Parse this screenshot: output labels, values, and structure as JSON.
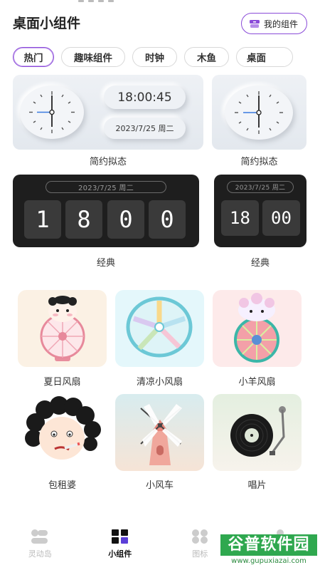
{
  "header": {
    "title": "桌面小组件",
    "my_widgets_label": "我的组件"
  },
  "tabs": [
    {
      "label": "热门",
      "active": true
    },
    {
      "label": "趣味组件",
      "active": false
    },
    {
      "label": "时钟",
      "active": false
    },
    {
      "label": "木鱼",
      "active": false
    },
    {
      "label": "桌面",
      "active": false
    }
  ],
  "widgets": {
    "simple_large": {
      "time": "18:00:45",
      "date": "2023/7/25 周二",
      "caption": "简约拟态"
    },
    "simple_small": {
      "caption": "简约拟态"
    },
    "classic_large": {
      "date": "2023/7/25 周二",
      "digits": [
        "1",
        "8",
        "0",
        "0"
      ],
      "caption": "经典"
    },
    "classic_small": {
      "date": "2023/7/25 周二",
      "digits": [
        "18",
        "00"
      ],
      "caption": "经典"
    }
  },
  "grid": [
    {
      "caption": "夏日风扇"
    },
    {
      "caption": "清凉小风扇"
    },
    {
      "caption": "小羊风扇"
    },
    {
      "caption": "包租婆"
    },
    {
      "caption": "小风车"
    },
    {
      "caption": "唱片"
    }
  ],
  "nav": [
    {
      "label": "灵动岛",
      "icon": "island-icon"
    },
    {
      "label": "小组件",
      "icon": "widgets-icon",
      "active": true
    },
    {
      "label": "图标",
      "icon": "icons-icon"
    },
    {
      "label": "我的",
      "icon": "profile-icon"
    }
  ],
  "watermark": {
    "line1": "谷普软件园",
    "line2": "www.gupuxiazai.com"
  },
  "colors": {
    "accent": "#8a4bd8",
    "dark_card": "#1e1e1e",
    "digit_bg": "#3a3a3a"
  }
}
